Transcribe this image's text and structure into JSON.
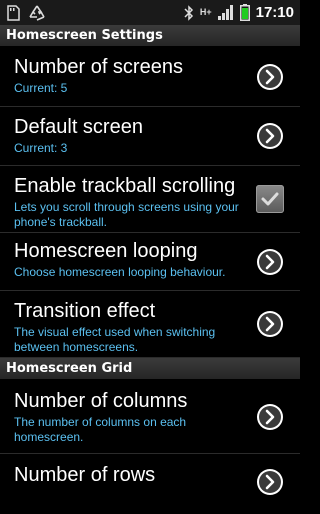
{
  "status_bar": {
    "left_icons": [
      "sdcard-icon",
      "recycle-icon"
    ],
    "bluetooth_icon": "bluetooth-icon",
    "network_label": "H+",
    "time": "17:10",
    "battery_color": "#22cc22"
  },
  "sections": [
    {
      "header": "Homescreen Settings",
      "items": [
        {
          "title": "Number of screens",
          "summary": "Current: 5",
          "control": "chevron"
        },
        {
          "title": "Default screen",
          "summary": "Current: 3",
          "control": "chevron"
        },
        {
          "title": "Enable trackball scrolling",
          "summary": "Lets you scroll through screens using your phone's trackball.",
          "control": "checkbox",
          "checked": true
        },
        {
          "title": "Homescreen looping",
          "summary": "Choose homescreen looping behaviour.",
          "control": "chevron"
        },
        {
          "title": "Transition effect",
          "summary": "The visual effect used when switching between homescreens.",
          "control": "chevron"
        }
      ]
    },
    {
      "header": "Homescreen Grid",
      "items": [
        {
          "title": "Number of columns",
          "summary": "The number of columns on each homescreen.",
          "control": "chevron"
        },
        {
          "title": "Number of rows",
          "summary": "",
          "control": "chevron"
        }
      ]
    }
  ],
  "colors": {
    "summary_text": "#5bc0f0",
    "header_bg": "#2f2f2f",
    "background": "#000000"
  }
}
